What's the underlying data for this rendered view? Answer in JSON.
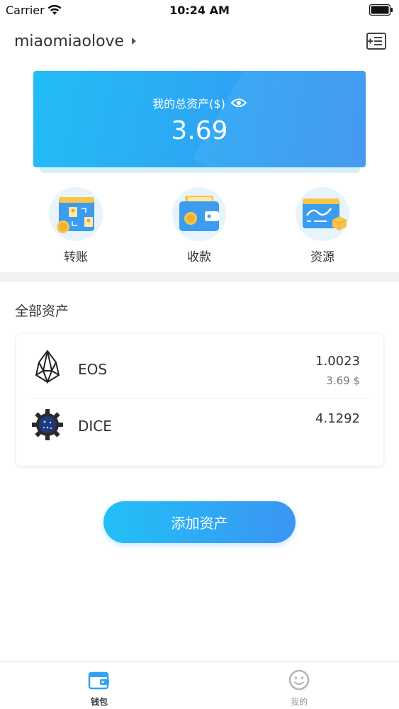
{
  "status_bar": {
    "carrier": "Carrier",
    "time": "10:24 AM"
  },
  "header": {
    "account_name": "miaomiaolove"
  },
  "total_assets": {
    "label": "我的总资产($)",
    "value": "3.69"
  },
  "actions": [
    {
      "label": "转账",
      "icon": "transfer-icon"
    },
    {
      "label": "收款",
      "icon": "receive-wallet-icon"
    },
    {
      "label": "资源",
      "icon": "resources-icon"
    }
  ],
  "assets_section": {
    "title": "全部资产"
  },
  "assets": [
    {
      "name": "EOS",
      "amount": "1.0023",
      "usd": "3.69 $",
      "icon": "eos-logo-icon"
    },
    {
      "name": "DICE",
      "amount": "4.1292",
      "icon": "dice-logo-icon"
    }
  ],
  "add_button": {
    "label": "添加资产"
  },
  "tabs": [
    {
      "label": "钱包",
      "icon": "wallet-tab-icon",
      "active": true
    },
    {
      "label": "我的",
      "icon": "smiley-tab-icon",
      "active": false
    }
  ],
  "colors": {
    "accent_start": "#22c0f7",
    "accent_end": "#3a95f3",
    "divider": "#f0f1f3"
  }
}
